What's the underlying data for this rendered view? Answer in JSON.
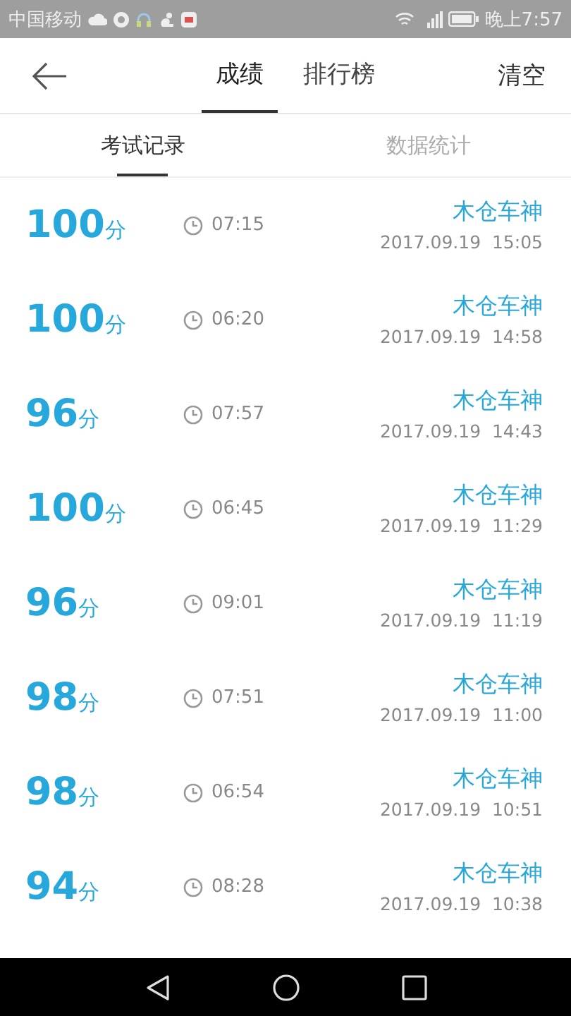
{
  "status_bar": {
    "carrier": "中国移动",
    "time": "晚上7:57"
  },
  "header": {
    "tabs": [
      {
        "label": "成绩",
        "selected": true
      },
      {
        "label": "排行榜",
        "selected": false
      }
    ],
    "action": "清空"
  },
  "subtabs": [
    {
      "label": "考试记录",
      "selected": true
    },
    {
      "label": "数据统计",
      "selected": false
    }
  ],
  "records": [
    {
      "score": "100",
      "unit": "分",
      "duration": "07:15",
      "name": "木仓车神",
      "date": "2017.09.19  15:05"
    },
    {
      "score": "100",
      "unit": "分",
      "duration": "06:20",
      "name": "木仓车神",
      "date": "2017.09.19  14:58"
    },
    {
      "score": "96",
      "unit": "分",
      "duration": "07:57",
      "name": "木仓车神",
      "date": "2017.09.19  14:43"
    },
    {
      "score": "100",
      "unit": "分",
      "duration": "06:45",
      "name": "木仓车神",
      "date": "2017.09.19  11:29"
    },
    {
      "score": "96",
      "unit": "分",
      "duration": "09:01",
      "name": "木仓车神",
      "date": "2017.09.19  11:19"
    },
    {
      "score": "98",
      "unit": "分",
      "duration": "07:51",
      "name": "木仓车神",
      "date": "2017.09.19  11:00"
    },
    {
      "score": "98",
      "unit": "分",
      "duration": "06:54",
      "name": "木仓车神",
      "date": "2017.09.19  10:51"
    },
    {
      "score": "94",
      "unit": "分",
      "duration": "08:28",
      "name": "木仓车神",
      "date": "2017.09.19  10:38"
    }
  ]
}
